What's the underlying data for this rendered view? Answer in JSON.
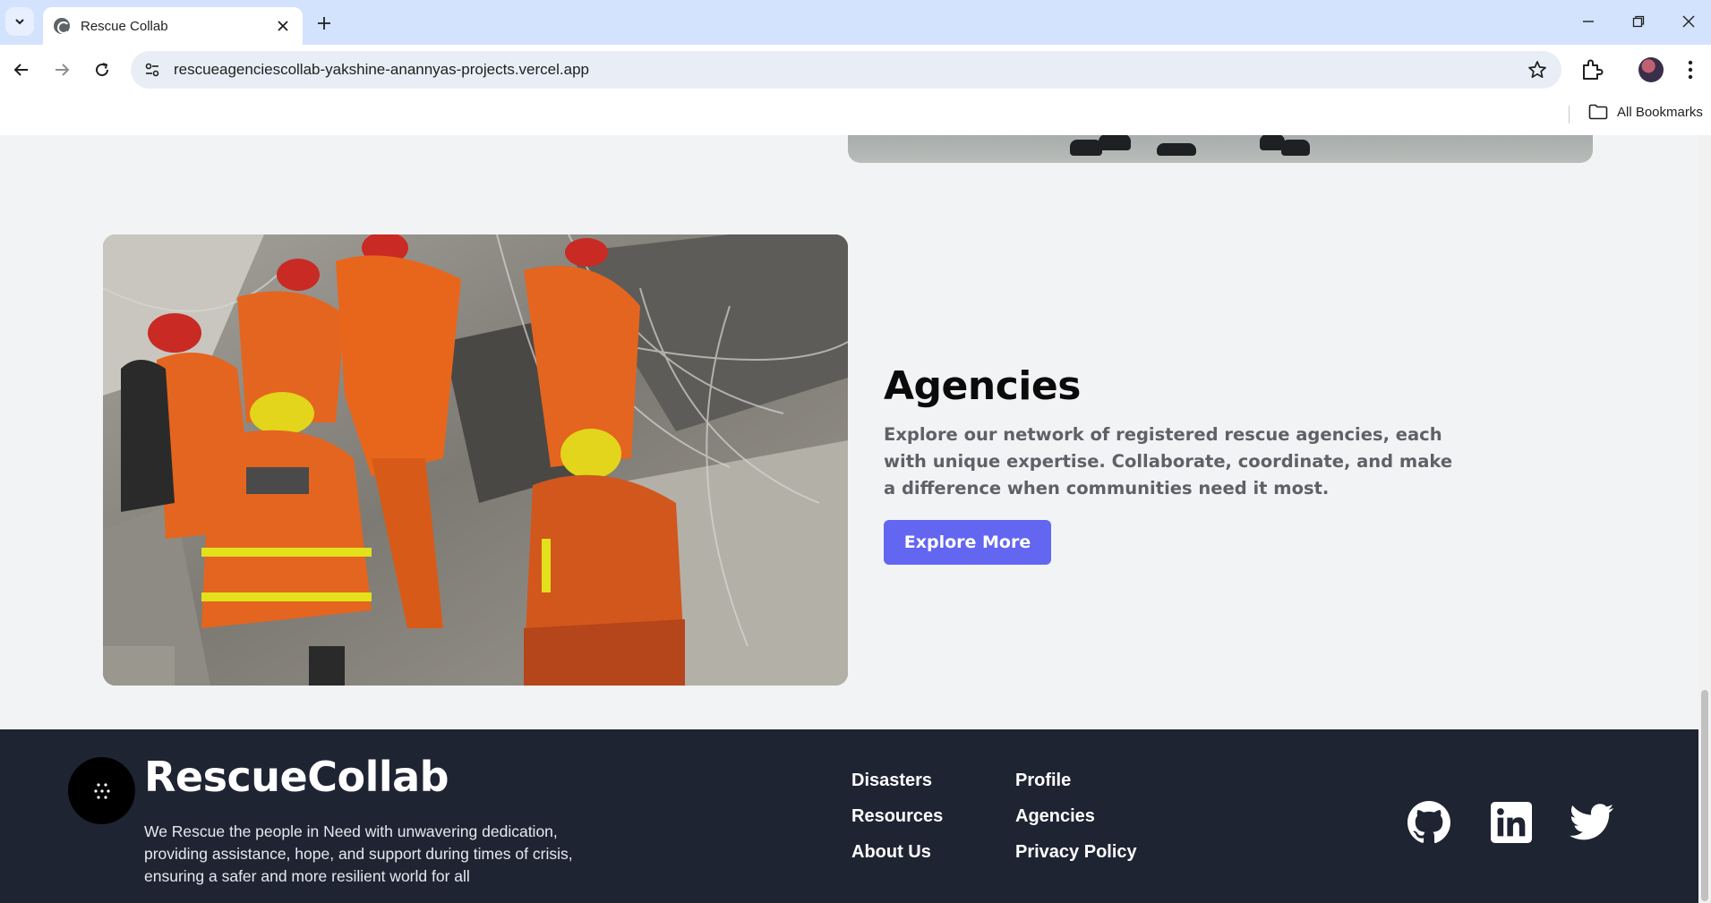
{
  "browser": {
    "tab_title": "Rescue Collab",
    "url": "rescueagenciescollab-yakshine-anannyas-projects.vercel.app",
    "bookmarks_label": "All Bookmarks"
  },
  "section": {
    "title": "Agencies",
    "description": "Explore our network of registered rescue agencies, each with unique expertise. Collaborate, coordinate, and make a difference when communities need it most.",
    "button_label": "Explore More"
  },
  "footer": {
    "brand": "RescueCollab",
    "tagline": "We Rescue the people in Need with unwavering dedication, providing assistance, hope, and support during times of crisis, ensuring a safer and more resilient world for all",
    "links": {
      "disasters": "Disasters",
      "resources": "Resources",
      "about": "About Us",
      "profile": "Profile",
      "agencies": "Agencies",
      "privacy": "Privacy Policy"
    },
    "social": [
      "github-icon",
      "linkedin-icon",
      "twitter-icon"
    ]
  },
  "colors": {
    "accent": "#6366f1",
    "footer_bg": "#1e2432",
    "page_bg": "#f2f3f5"
  }
}
